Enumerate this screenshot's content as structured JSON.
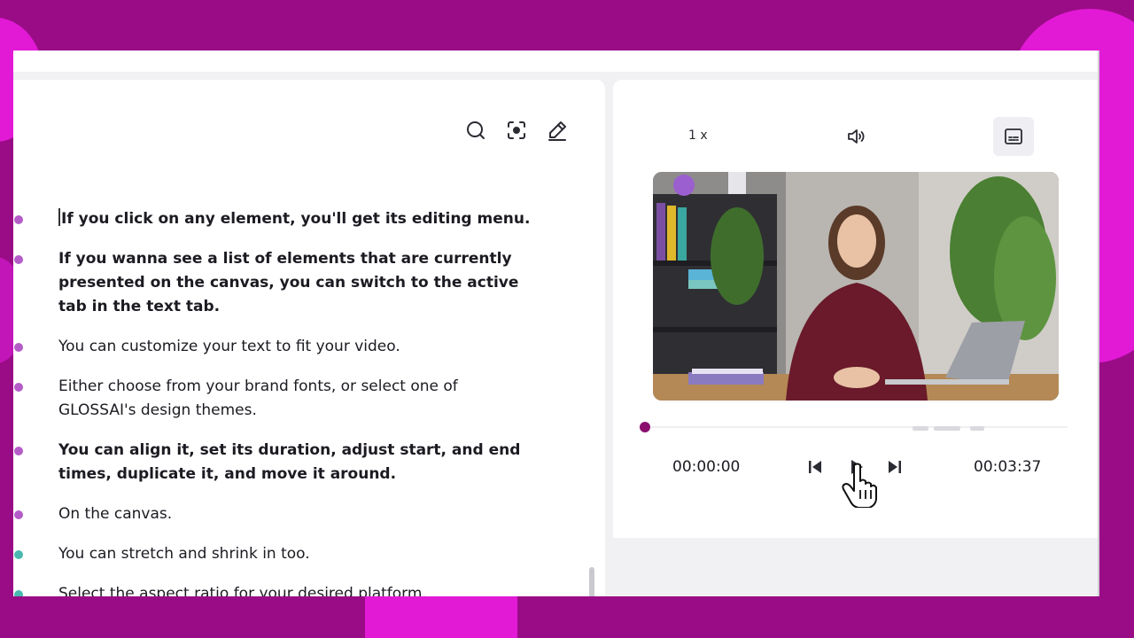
{
  "colors": {
    "background": "#9a0c86",
    "accent_blob": "#e21ad6",
    "playhead": "#8b0f6f",
    "dot_purple": "#b45cc7",
    "dot_teal": "#4ab8b0"
  },
  "toolbar": {
    "icons": [
      "search-icon",
      "focus-icon",
      "edit-icon"
    ]
  },
  "transcript": [
    {
      "text": "If you click on any element, you'll get its editing menu.",
      "bold": true,
      "dot": "purple"
    },
    {
      "text": "If you wanna see a list of elements that are currently presented on the canvas, you can switch to the active tab in the text tab.",
      "bold": true,
      "dot": "purple"
    },
    {
      "text": "You can customize your text to fit your video.",
      "bold": false,
      "dot": "purple"
    },
    {
      "text": "Either choose from your brand fonts, or select one of GLOSSAI's design themes.",
      "bold": false,
      "dot": "purple"
    },
    {
      "text": "You can align it, set its duration, adjust start, and end times, duplicate it, and move it around.",
      "bold": true,
      "dot": "purple"
    },
    {
      "text": "On the canvas.",
      "bold": false,
      "dot": "purple"
    },
    {
      "text": "You can stretch and shrink in too.",
      "bold": false,
      "dot": "teal"
    },
    {
      "text": "Select the aspect ratio for your desired platform.",
      "bold": false,
      "dot": "teal"
    }
  ],
  "player": {
    "speed": "1 x",
    "current_time": "00:00:00",
    "total_time": "00:03:37",
    "progress": 0,
    "icons": [
      "volume-icon",
      "captions-icon",
      "skip-back-icon",
      "play-icon",
      "skip-forward-icon"
    ]
  }
}
